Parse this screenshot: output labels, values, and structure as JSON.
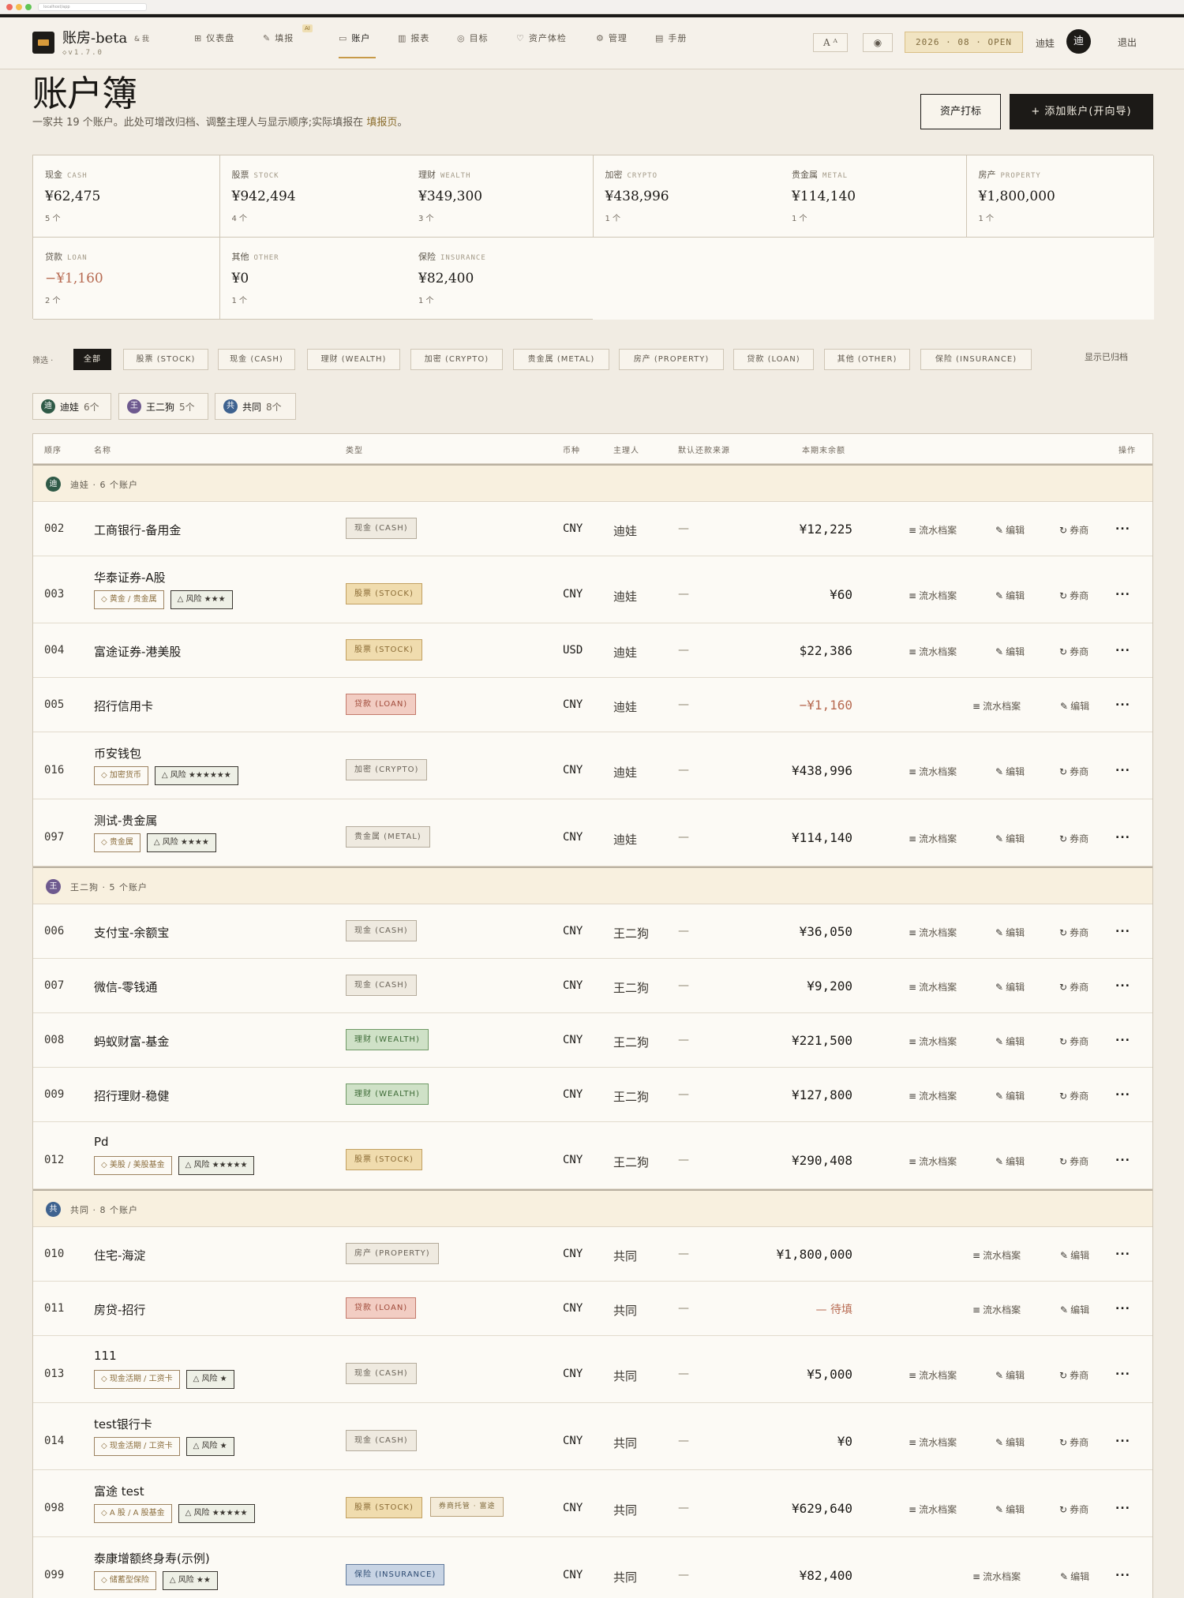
{
  "browser": {
    "address": "localhost/app"
  },
  "app": {
    "name": "账房-beta",
    "sub": "& 我",
    "version": "◇v1.7.0"
  },
  "nav": [
    {
      "label": "仪表盘",
      "icon": "⊞"
    },
    {
      "label": "填报",
      "icon": "✎",
      "badge": "AI"
    },
    {
      "label": "账户",
      "icon": "▭"
    },
    {
      "label": "报表",
      "icon": "▥"
    },
    {
      "label": "目标",
      "icon": "◎"
    },
    {
      "label": "资产体检",
      "icon": "♡"
    },
    {
      "label": "管理",
      "icon": "⚙"
    },
    {
      "label": "手册",
      "icon": "▤"
    }
  ],
  "header": {
    "font_button": "A ᴬ",
    "eye_icon": "◉",
    "period": "2026 · 08 · OPEN",
    "user": "迪娃",
    "avatar": "迪",
    "logout": "退出"
  },
  "page": {
    "title": "账户簿",
    "subtitle_pre": "一家共 19 个账户。此处可增改归档、调整主理人与显示顺序;实际填报在",
    "subtitle_link": "填报页",
    "subtitle_post": "。",
    "btn_tag": "资产打标",
    "btn_add": "+ 添加账户(开向导)"
  },
  "stats": [
    {
      "label": "现金",
      "en": "CASH",
      "value": "¥62,475",
      "count": "5 个"
    },
    {
      "label": "股票",
      "en": "STOCK",
      "value": "¥942,494",
      "count": "4 个"
    },
    {
      "label": "理财",
      "en": "WEALTH",
      "value": "¥349,300",
      "count": "3 个"
    },
    {
      "label": "加密",
      "en": "CRYPTO",
      "value": "¥438,996",
      "count": "1 个"
    },
    {
      "label": "贵金属",
      "en": "METAL",
      "value": "¥114,140",
      "count": "1 个"
    },
    {
      "label": "房产",
      "en": "PROPERTY",
      "value": "¥1,800,000",
      "count": "1 个"
    },
    {
      "label": "贷款",
      "en": "LOAN",
      "value": "−¥1,160",
      "count": "2 个",
      "negative": true
    },
    {
      "label": "其他",
      "en": "OTHER",
      "value": "¥0",
      "count": "1 个"
    },
    {
      "label": "保险",
      "en": "INSURANCE",
      "value": "¥82,400",
      "count": "1 个"
    }
  ],
  "filters": {
    "label": "筛选 ·",
    "chips": [
      "全部",
      "股票 (STOCK)",
      "现金 (CASH)",
      "理财 (WEALTH)",
      "加密 (CRYPTO)",
      "贵金属 (METAL)",
      "房产 (PROPERTY)",
      "贷款 (LOAN)",
      "其他 (OTHER)",
      "保险 (INSURANCE)"
    ],
    "show_archived": "显示已归档"
  },
  "owners": [
    {
      "avatar": "迪",
      "name": "迪娃",
      "count": "6个",
      "color": "#2f5a47"
    },
    {
      "avatar": "王",
      "name": "王二狗",
      "count": "5个",
      "color": "#6e5a8f"
    },
    {
      "avatar": "共",
      "name": "共同",
      "count": "8个",
      "color": "#3e628f"
    }
  ],
  "table": {
    "headers": [
      "顺序",
      "名称",
      "类型",
      "币种",
      "主理人",
      "默认还款来源",
      "本期末余额",
      "操作"
    ],
    "actions": {
      "ledger": "流水档案",
      "edit": "编辑",
      "broker": "券商",
      "ledger_icon": "≡",
      "edit_icon": "✎",
      "broker_icon": "↻",
      "more": "..."
    },
    "groups": [
      {
        "avatar": "迪",
        "color": "#2f5a47",
        "title": "迪娃 · 6 个账户",
        "rows": [
          {
            "order": "002",
            "name": "工商银行-备用金",
            "type": "现金 (CASH)",
            "tclass": "t-cash",
            "currency": "CNY",
            "owner": "迪娃",
            "source": "—",
            "balance": "¥12,225",
            "broker": true,
            "tags": []
          },
          {
            "order": "003",
            "name": "华泰证券-A股",
            "type": "股票 (STOCK)",
            "tclass": "t-stock",
            "currency": "CNY",
            "owner": "迪娃",
            "source": "—",
            "balance": "¥60",
            "broker": true,
            "tags": [
              "◇ 黄金 / 贵金属"
            ],
            "risk": "△ 风险 ★★★"
          },
          {
            "order": "004",
            "name": "富途证券-港美股",
            "type": "股票 (STOCK)",
            "tclass": "t-stock",
            "currency": "USD",
            "owner": "迪娃",
            "source": "—",
            "balance": "$22,386",
            "broker": true,
            "tags": []
          },
          {
            "order": "005",
            "name": "招行信用卡",
            "type": "贷款 (LOAN)",
            "tclass": "t-loan",
            "currency": "CNY",
            "owner": "迪娃",
            "source": "—",
            "balance": "−¥1,160",
            "bclass": "neg",
            "broker": false,
            "tags": []
          },
          {
            "order": "016",
            "name": "币安钱包",
            "type": "加密 (CRYPTO)",
            "tclass": "t-crypto",
            "currency": "CNY",
            "owner": "迪娃",
            "source": "—",
            "balance": "¥438,996",
            "broker": true,
            "tags": [
              "◇ 加密货币"
            ],
            "risk": "△ 风险 ★★★★★★"
          },
          {
            "order": "097",
            "name": "测试-贵金属",
            "type": "贵金属 (METAL)",
            "tclass": "t-metal",
            "currency": "CNY",
            "owner": "迪娃",
            "source": "—",
            "balance": "¥114,140",
            "broker": true,
            "tags": [
              "◇ 贵金属"
            ],
            "risk": "△ 风险 ★★★★"
          }
        ]
      },
      {
        "avatar": "王",
        "color": "#6e5a8f",
        "title": "王二狗 · 5 个账户",
        "rows": [
          {
            "order": "006",
            "name": "支付宝-余额宝",
            "type": "现金 (CASH)",
            "tclass": "t-cash",
            "currency": "CNY",
            "owner": "王二狗",
            "source": "—",
            "balance": "¥36,050",
            "broker": true,
            "tags": []
          },
          {
            "order": "007",
            "name": "微信-零钱通",
            "type": "现金 (CASH)",
            "tclass": "t-cash",
            "currency": "CNY",
            "owner": "王二狗",
            "source": "—",
            "balance": "¥9,200",
            "broker": true,
            "tags": []
          },
          {
            "order": "008",
            "name": "蚂蚁财富-基金",
            "type": "理财 (WEALTH)",
            "tclass": "t-wealth",
            "currency": "CNY",
            "owner": "王二狗",
            "source": "—",
            "balance": "¥221,500",
            "broker": true,
            "tags": []
          },
          {
            "order": "009",
            "name": "招行理财-稳健",
            "type": "理财 (WEALTH)",
            "tclass": "t-wealth",
            "currency": "CNY",
            "owner": "王二狗",
            "source": "—",
            "balance": "¥127,800",
            "broker": true,
            "tags": []
          },
          {
            "order": "012",
            "name": "Pd",
            "type": "股票 (STOCK)",
            "tclass": "t-stock",
            "currency": "CNY",
            "owner": "王二狗",
            "source": "—",
            "balance": "¥290,408",
            "broker": true,
            "tags": [
              "◇ 美股 / 美股基金"
            ],
            "risk": "△ 风险 ★★★★★"
          }
        ]
      },
      {
        "avatar": "共",
        "color": "#3e628f",
        "title": "共同 · 8 个账户",
        "rows": [
          {
            "order": "010",
            "name": "住宅-海淀",
            "type": "房产 (PROPERTY)",
            "tclass": "t-property",
            "currency": "CNY",
            "owner": "共同",
            "source": "—",
            "balance": "¥1,800,000",
            "broker": false,
            "tags": []
          },
          {
            "order": "011",
            "name": "房贷-招行",
            "type": "贷款 (LOAN)",
            "tclass": "t-loan",
            "currency": "CNY",
            "owner": "共同",
            "source": "—",
            "balance": "— 待填",
            "bclass": "pend",
            "broker": false,
            "tags": []
          },
          {
            "order": "013",
            "name": "111",
            "type": "现金 (CASH)",
            "tclass": "t-cash",
            "currency": "CNY",
            "owner": "共同",
            "source": "—",
            "balance": "¥5,000",
            "broker": true,
            "tags": [
              "◇ 现金活期 / 工资卡"
            ],
            "risk": "△ 风险 ★"
          },
          {
            "order": "014",
            "name": "test银行卡",
            "type": "现金 (CASH)",
            "tclass": "t-cash",
            "currency": "CNY",
            "owner": "共同",
            "source": "—",
            "balance": "¥0",
            "broker": true,
            "tags": [
              "◇ 现金活期 / 工资卡"
            ],
            "risk": "△ 风险 ★"
          },
          {
            "order": "098",
            "name": "富途 test",
            "type": "股票 (STOCK)",
            "tclass": "t-stock",
            "sub": "券商托管 · 富途",
            "currency": "CNY",
            "owner": "共同",
            "source": "—",
            "balance": "¥629,640",
            "broker": true,
            "tags": [
              "◇ A 股 / A 股基金"
            ],
            "risk": "△ 风险 ★★★★★"
          },
          {
            "order": "099",
            "name": "泰康增额终身寿(示例)",
            "type": "保险 (INSURANCE)",
            "tclass": "t-ins",
            "currency": "CNY",
            "owner": "共同",
            "source": "—",
            "balance": "¥82,400",
            "broker": false,
            "tags": [
              "◇ 储蓄型保险"
            ],
            "risk": "△ 风险 ★★"
          }
        ]
      }
    ]
  }
}
